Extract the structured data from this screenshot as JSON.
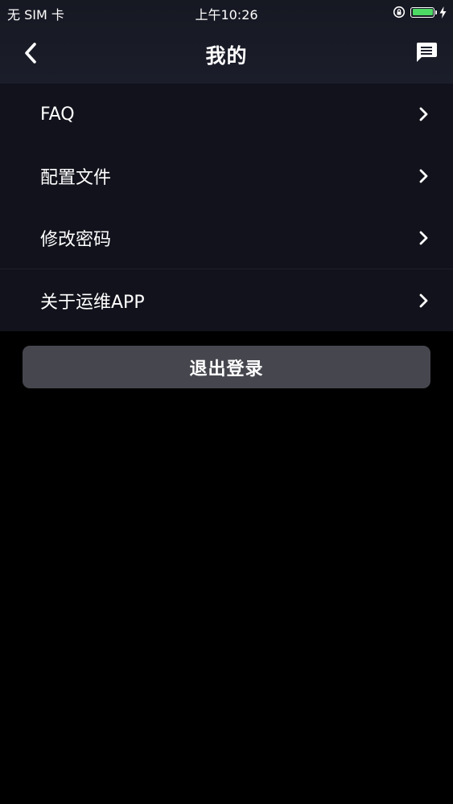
{
  "status_bar": {
    "carrier": "无 SIM 卡",
    "time": "上午10:26",
    "battery_level": 1.0,
    "battery_color": "#4cd964"
  },
  "nav": {
    "title": "我的",
    "back_icon": "chevron-left-icon",
    "message_icon": "chat-bubble-icon"
  },
  "menu": {
    "items": [
      {
        "label": "FAQ"
      },
      {
        "label": "配置文件"
      },
      {
        "label": "修改密码"
      },
      {
        "label": "关于运维APP"
      }
    ],
    "chevron_icon": "chevron-right-icon"
  },
  "logout": {
    "label": "退出登录"
  },
  "colors": {
    "background": "#000000",
    "header": "#1b1e2a",
    "menu_background": "#11121b",
    "button": "#46474e"
  }
}
